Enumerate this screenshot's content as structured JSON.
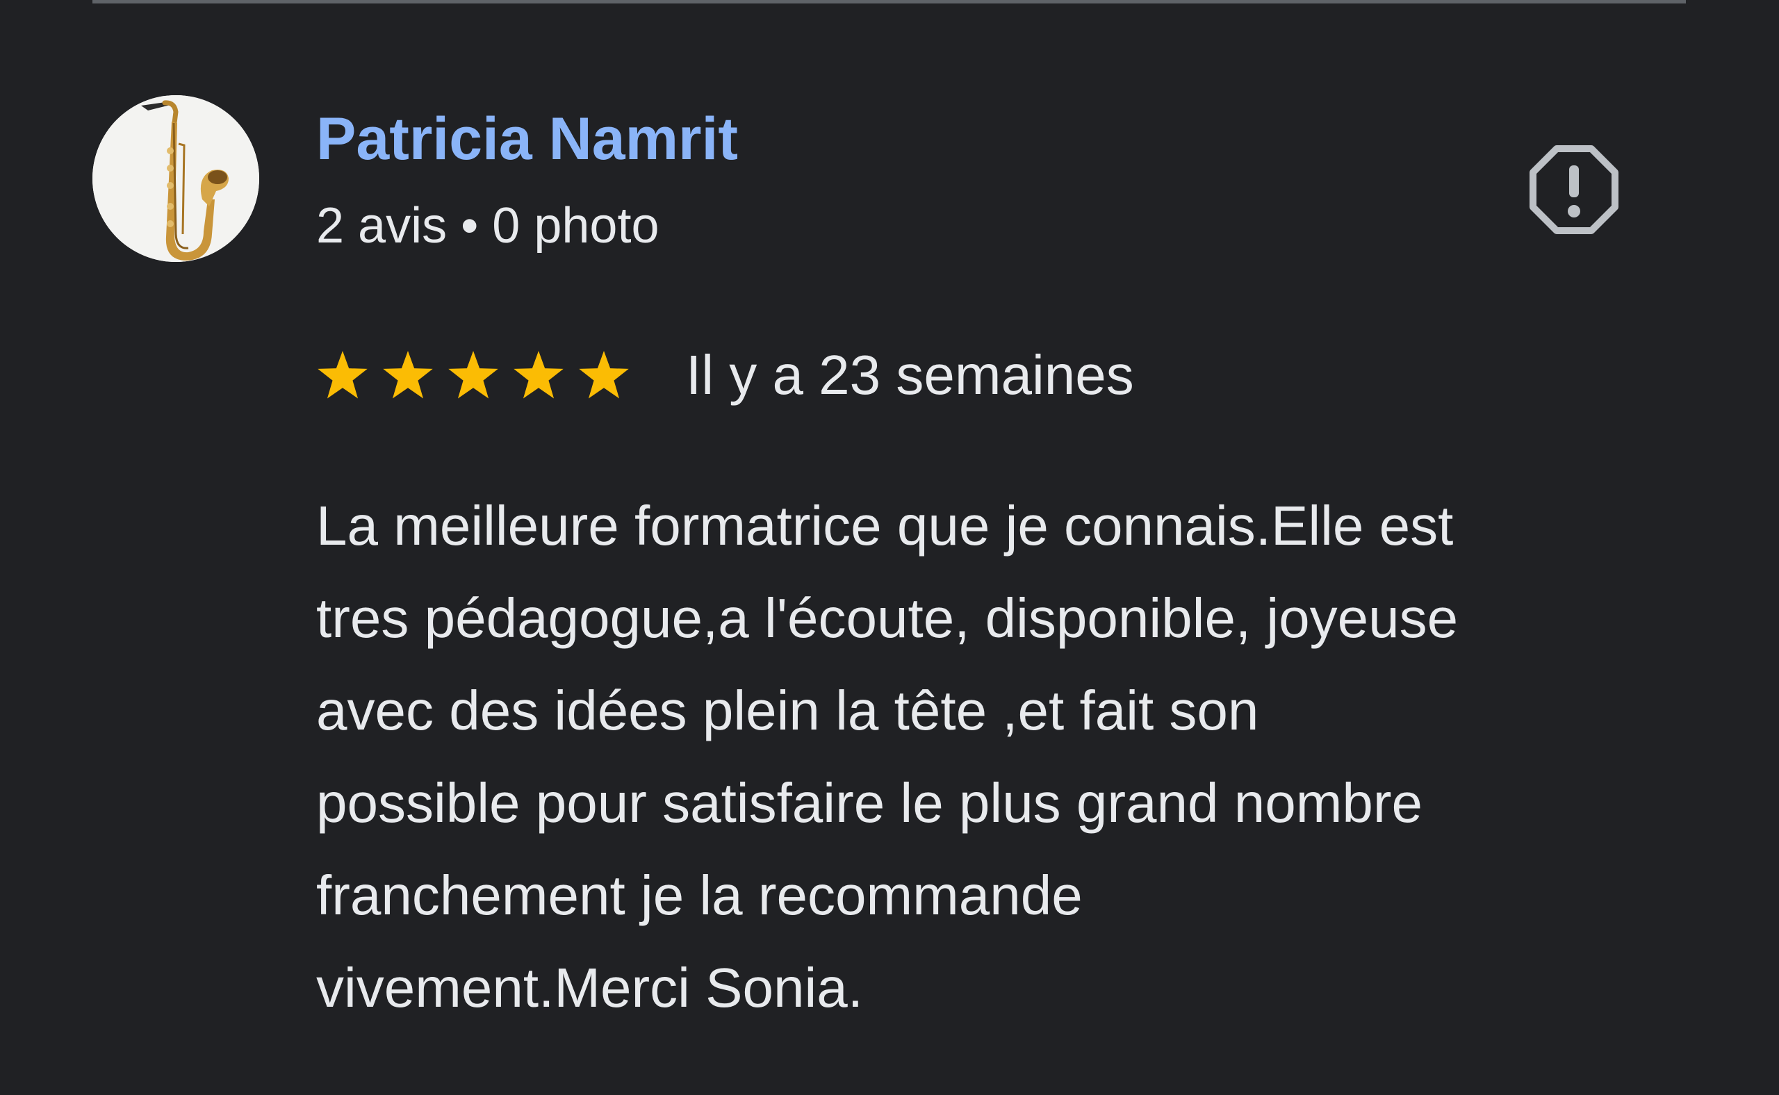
{
  "reviewer": {
    "name": "Patricia Namrit",
    "meta": "2 avis • 0 photo",
    "avatar_icon": "saxophone-avatar"
  },
  "actions": {
    "report_icon": "report-icon"
  },
  "review": {
    "rating": 5,
    "rating_max": 5,
    "date": "Il y a 23 semaines",
    "text_lines": [
      "La meilleure formatrice que je connais.Elle est",
      "tres pédagogue,a l'écoute, disponible, joyeuse",
      "avec des idées plein la tête ,et fait son",
      "possible pour satisfaire le plus grand nombre",
      "franchement je la recommande",
      "vivement.Merci Sonia."
    ]
  },
  "colors": {
    "background": "#202124",
    "name": "#8ab4f8",
    "text": "#e8eaed",
    "star": "#fbbc04",
    "icon": "#bdc1c6"
  }
}
